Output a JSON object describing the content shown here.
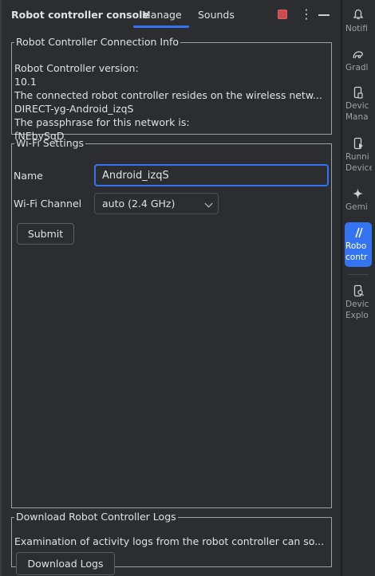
{
  "header": {
    "title": "Robot controller console",
    "tabs": [
      {
        "label": "Manage",
        "active": true
      },
      {
        "label": "Sounds",
        "active": false
      }
    ],
    "icons": [
      "stop-icon",
      "more-vertical-icon",
      "minimize-icon"
    ]
  },
  "connection_info": {
    "legend": "Robot Controller Connection Info",
    "lines": [
      "Robot Controller version:",
      "10.1",
      "The connected robot controller resides on the wireless netw...",
      "DIRECT-yg-Android_izqS",
      "The passphrase for this network is:",
      "fNEbySqD"
    ]
  },
  "wifi_settings": {
    "legend": "Wi-Fi Settings",
    "name_label": "Name",
    "name_value": "Android_izqS",
    "channel_label": "Wi-Fi Channel",
    "channel_value": "auto (2.4 GHz)",
    "submit_label": "Submit"
  },
  "logs": {
    "legend": "Download Robot Controller Logs",
    "description": "Examination of activity logs from the robot controller can so...",
    "button_label": "Download Logs"
  },
  "right_strip": {
    "items": [
      {
        "icon": "bell-icon",
        "label": "Notifi"
      },
      {
        "icon": "gradle-icon",
        "label": "Gradl"
      },
      {
        "icon": "device-manager-icon",
        "label_lines": [
          "Devic",
          "Mana"
        ]
      },
      {
        "icon": "running-devices-icon",
        "label_lines": [
          "Runni",
          "Device"
        ]
      },
      {
        "icon": "gemini-icon",
        "label": "Gemi"
      },
      {
        "icon": "robot-controller-icon",
        "label_lines": [
          "Robo",
          "contr"
        ],
        "active": true
      },
      {
        "icon": "device-explorer-icon",
        "label_lines": [
          "Devic",
          "Explo"
        ]
      }
    ]
  },
  "colors": {
    "accent": "#3574f0",
    "background": "#2b2d30",
    "stop": "#c94f4f"
  }
}
